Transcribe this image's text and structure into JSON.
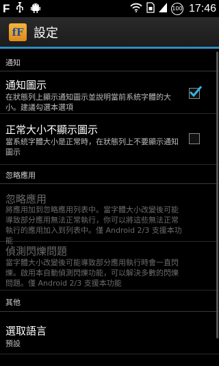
{
  "status": {
    "time": "17:46",
    "battery_level": "100"
  },
  "header": {
    "app_icon_text": "fF",
    "title": "設定"
  },
  "sections": [
    {
      "header": "通知",
      "items": [
        {
          "title": "通知圖示",
          "summary": "在狀態列上顯示通知圖示並說明當前系統字體的大小。建議勾選本選項",
          "checked": true
        },
        {
          "title": "正常大小不顯示圖示",
          "summary": "當系統字體大小是正常時，在狀態列上不要顯示通知圖示",
          "checked": false
        }
      ]
    },
    {
      "header": "忽略應用",
      "items": [
        {
          "title": "忽略應用",
          "summary": "將應用加到忽略應用列表中。當字體大小改變後可能導致部分應用無法正常執行，你可以將這些無法正常執行的應用加入到列表中。僅 Android 2/3 支援本功能",
          "enabled": false
        },
        {
          "title": "偵測閃爍問題",
          "summary": "當字體大小改變後可能導致部分應用執行時會一直閃爍。啟用本自動偵測閃爍功能，可以解決多數的閃爍問題。僅 Android 2/3 支援本功能",
          "enabled": false
        }
      ]
    },
    {
      "header": "其他",
      "items": [
        {
          "title": "選取語言",
          "summary": "預設"
        }
      ]
    }
  ],
  "colors": {
    "accent": "#2b8fc1",
    "checkmark": "#33b5e5"
  }
}
